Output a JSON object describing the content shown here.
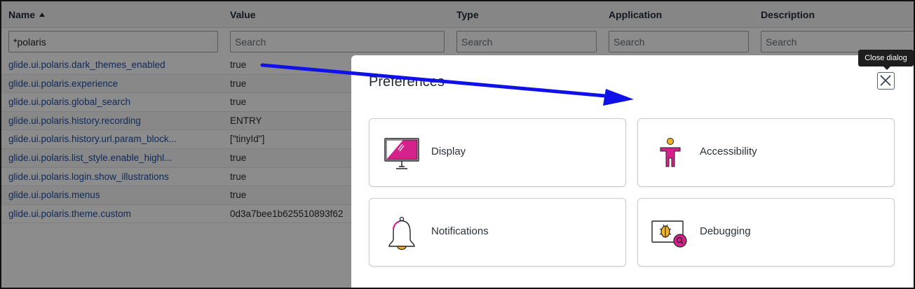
{
  "list": {
    "columns": [
      {
        "label": "Name",
        "sorted": "ascending"
      },
      {
        "label": "Value"
      },
      {
        "label": "Type"
      },
      {
        "label": "Application"
      },
      {
        "label": "Description"
      }
    ],
    "filters": [
      {
        "value": "*polaris",
        "placeholder": "Search"
      },
      {
        "value": "",
        "placeholder": "Search"
      },
      {
        "value": "",
        "placeholder": "Search"
      },
      {
        "value": "",
        "placeholder": "Search"
      },
      {
        "value": "",
        "placeholder": "Search"
      }
    ],
    "rows": [
      {
        "name": "glide.ui.polaris.dark_themes_enabled",
        "value": "true"
      },
      {
        "name": "glide.ui.polaris.experience",
        "value": "true"
      },
      {
        "name": "glide.ui.polaris.global_search",
        "value": "true"
      },
      {
        "name": "glide.ui.polaris.history.recording",
        "value": "ENTRY"
      },
      {
        "name": "glide.ui.polaris.history.url.param_block...",
        "value": "[\"tinyId\"]"
      },
      {
        "name": "glide.ui.polaris.list_style.enable_highl...",
        "value": "true"
      },
      {
        "name": "glide.ui.polaris.login.show_illustrations",
        "value": "true"
      },
      {
        "name": "glide.ui.polaris.menus",
        "value": "true"
      },
      {
        "name": "glide.ui.polaris.theme.custom",
        "value": "0d3a7bee1b625510893f62"
      }
    ]
  },
  "dialog": {
    "title": "Preferences",
    "close_tooltip": "Close dialog",
    "close_icon": "close-icon",
    "cards": [
      {
        "label": "Display",
        "icon": "monitor-icon"
      },
      {
        "label": "Accessibility",
        "icon": "accessibility-person-icon"
      },
      {
        "label": "Notifications",
        "icon": "bell-icon"
      },
      {
        "label": "Debugging",
        "icon": "bug-search-icon"
      }
    ]
  },
  "colors": {
    "link": "#1d4fa6",
    "accent_magenta": "#d4218c",
    "accent_yellow": "#f4b321",
    "annotation_arrow": "#1010e8",
    "close_button_border": "#3b5cc6"
  }
}
